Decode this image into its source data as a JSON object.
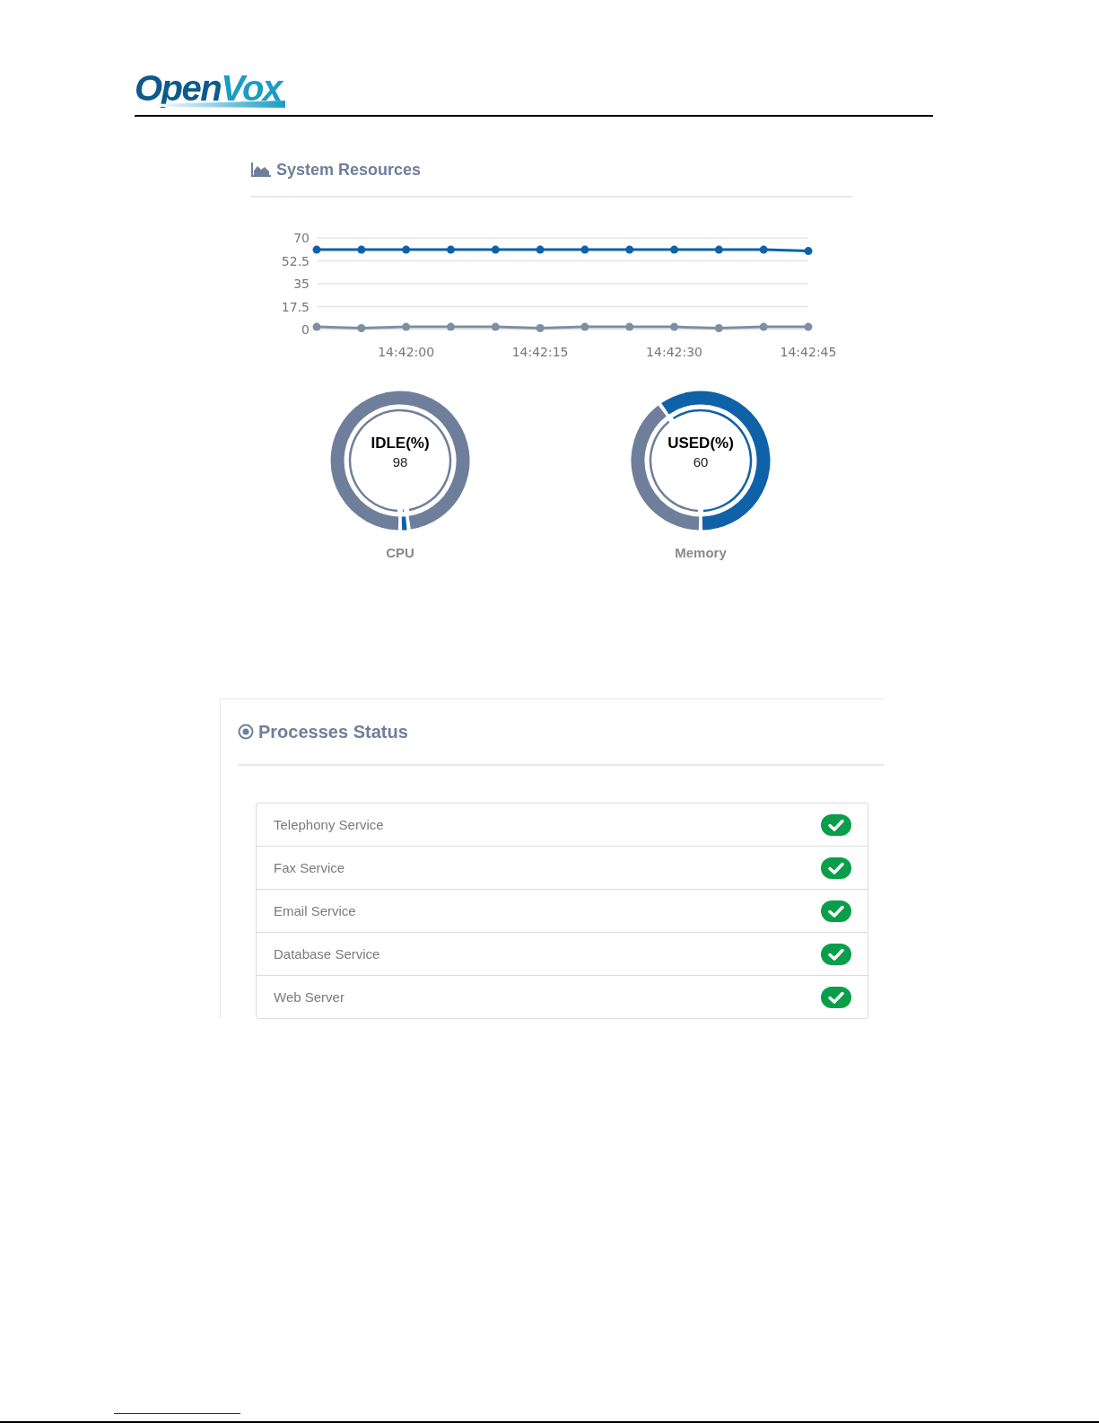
{
  "logo": {
    "primary": "Open",
    "secondary": "Vox"
  },
  "system_resources": {
    "title": "System Resources",
    "chart_data": {
      "type": "line",
      "grid": true,
      "categories": [
        null,
        null,
        "14:42:00",
        null,
        null,
        "14:42:15",
        null,
        null,
        "14:42:30",
        null,
        null,
        "14:42:45"
      ],
      "ylim": [
        0,
        70
      ],
      "yticks": [
        0,
        17.5,
        35,
        52.5,
        70
      ],
      "series": [
        {
          "color": "#0f62a8",
          "marker": "circle",
          "values": [
            61,
            61,
            61,
            61,
            61,
            61,
            61,
            61,
            61,
            61,
            61,
            60
          ]
        },
        {
          "color": "#7d8fa3",
          "marker": "circle",
          "values": [
            2,
            1,
            2,
            2,
            2,
            1,
            2,
            2,
            2,
            1,
            2,
            2
          ]
        }
      ]
    },
    "gauges": [
      {
        "kind": "idle",
        "heading": "IDLE(%)",
        "value": "98",
        "label": "CPU"
      },
      {
        "kind": "used",
        "heading": "USED(%)",
        "value": "60",
        "label": "Memory"
      }
    ]
  },
  "processes_status": {
    "title": "Processes Status",
    "services": [
      {
        "name": "Telephony Service",
        "running": true
      },
      {
        "name": "Fax Service",
        "running": true
      },
      {
        "name": "Email Service",
        "running": true
      },
      {
        "name": "Database Service",
        "running": true
      },
      {
        "name": "Web Server",
        "running": true
      }
    ]
  }
}
